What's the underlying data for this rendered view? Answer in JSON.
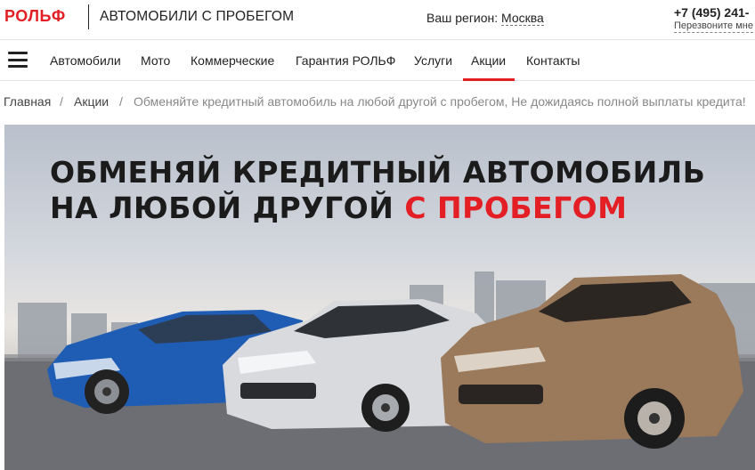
{
  "header": {
    "logo": "РОЛЬФ",
    "tagline": "АВТОМОБИЛИ С ПРОБЕГОМ",
    "region_label": "Ваш регион:",
    "region_value": "Москва",
    "phone": "+7 (495) 241-",
    "callback": "Перезвоните мне"
  },
  "nav": {
    "menu_icon": "hamburger-menu-icon",
    "items": [
      "Автомобили",
      "Мото",
      "Коммерческие",
      "Гарантия РОЛЬФ",
      "Услуги",
      "Акции",
      "Контакты"
    ],
    "active": "Акции"
  },
  "breadcrumb": {
    "items": [
      "Главная",
      "Акции"
    ],
    "separator": "/",
    "current": "Обменяйте кредитный автомобиль на любой другой с пробегом, Не дожидаясь полной выплаты кредита!"
  },
  "banner": {
    "line1": "ОБМЕНЯЙ КРЕДИТНЫЙ АВТОМОБИЛЬ",
    "line2_prefix": "НА ЛЮБОЙ ДРУГОЙ ",
    "line2_accent": "С ПРОБЕГОМ",
    "cars": [
      "blue-hatchback",
      "silver-sedan",
      "bronze-suv"
    ]
  },
  "colors": {
    "brand_red": "#e31e24",
    "text": "#222222",
    "muted": "#888888"
  }
}
